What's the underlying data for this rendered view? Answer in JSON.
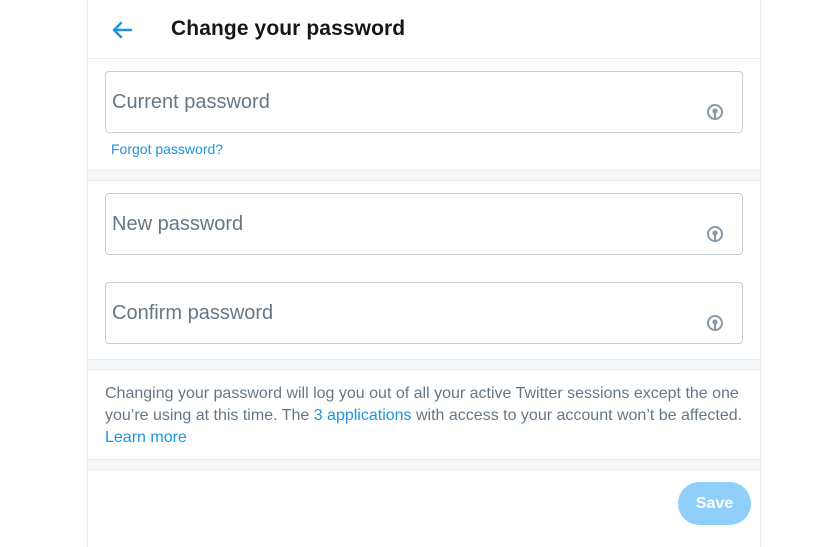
{
  "header": {
    "title": "Change your password"
  },
  "form": {
    "current_password": {
      "placeholder": "Current password",
      "value": ""
    },
    "forgot_link": "Forgot password?",
    "new_password": {
      "placeholder": "New password",
      "value": ""
    },
    "confirm_password": {
      "placeholder": "Confirm password",
      "value": ""
    }
  },
  "info": {
    "text_part1": "Changing your password will log you out of all your active Twitter sessions except the one you’re using at this time. The ",
    "apps_link": "3 applications",
    "text_part2": " with access to your account won’t be affected. ",
    "learn_more": "Learn more"
  },
  "actions": {
    "save_label": "Save"
  },
  "colors": {
    "accent": "#1b95e0",
    "save_disabled": "#8ed0f9",
    "text_primary": "#14171a",
    "text_secondary": "#657786",
    "border": "#c4cfd6"
  },
  "icons": {
    "back": "arrow-left-icon",
    "reveal": "eye-reveal-icon"
  }
}
